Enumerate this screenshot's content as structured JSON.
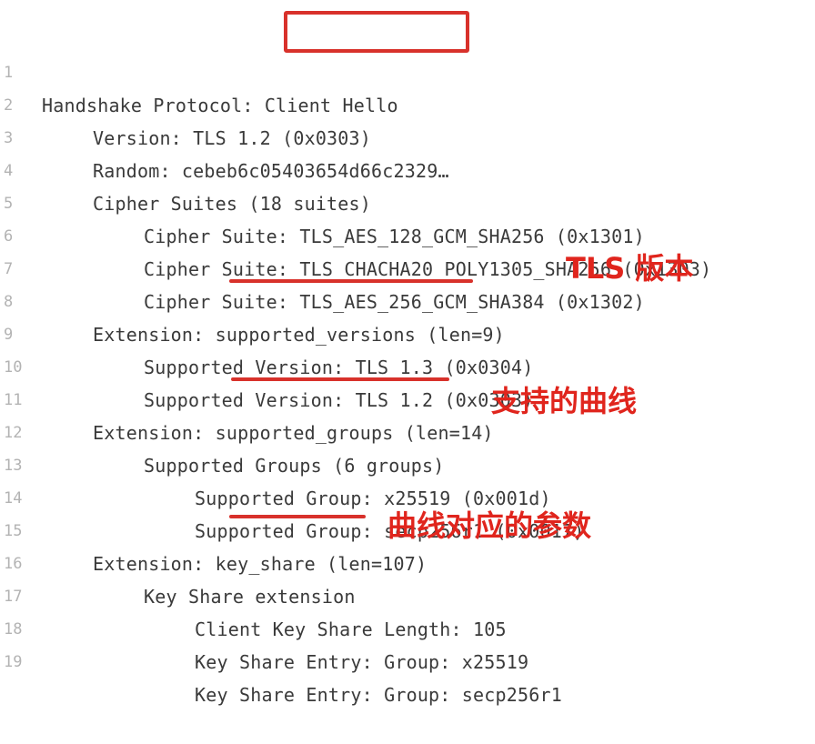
{
  "lines": [
    {
      "n": "1",
      "text": "Handshake Protocol: Client Hello"
    },
    {
      "n": "2",
      "text": "Version: TLS 1.2 (0x0303)"
    },
    {
      "n": "3",
      "text": "Random: cebeb6c05403654d66c2329…"
    },
    {
      "n": "4",
      "text": "Cipher Suites (18 suites)"
    },
    {
      "n": "5",
      "text": "Cipher Suite: TLS_AES_128_GCM_SHA256 (0x1301)"
    },
    {
      "n": "6",
      "text": "Cipher Suite: TLS_CHACHA20_POLY1305_SHA256 (0x1303)"
    },
    {
      "n": "7",
      "text": "Cipher Suite: TLS_AES_256_GCM_SHA384 (0x1302)"
    },
    {
      "n": "8",
      "text": "Extension: supported_versions (len=9)"
    },
    {
      "n": "9",
      "text": "Supported Version: TLS 1.3 (0x0304)"
    },
    {
      "n": "10",
      "text": "Supported Version: TLS 1.2 (0x0303)"
    },
    {
      "n": "11",
      "text": "Extension: supported_groups (len=14)"
    },
    {
      "n": "12",
      "text": "Supported Groups (6 groups)"
    },
    {
      "n": "13",
      "text": "Supported Group: x25519 (0x001d)"
    },
    {
      "n": "14",
      "text": "Supported Group: secp256r1 (0x0017)"
    },
    {
      "n": "15",
      "text": "Extension: key_share (len=107)"
    },
    {
      "n": "16",
      "text": "Key Share extension"
    },
    {
      "n": "17",
      "text": "Client Key Share Length: 105"
    },
    {
      "n": "18",
      "text": "Key Share Entry: Group: x25519"
    },
    {
      "n": "19",
      "text": "Key Share Entry: Group: secp256r1"
    }
  ],
  "annotations": {
    "tls_version": "TLS 版本",
    "supported_curves": "支持的曲线",
    "curve_params": "曲线对应的参数"
  },
  "colors": {
    "accent": "#d8312b",
    "annotation": "#e0251d",
    "code_text": "#3a3a3a",
    "line_number": "#b3b3b3"
  }
}
